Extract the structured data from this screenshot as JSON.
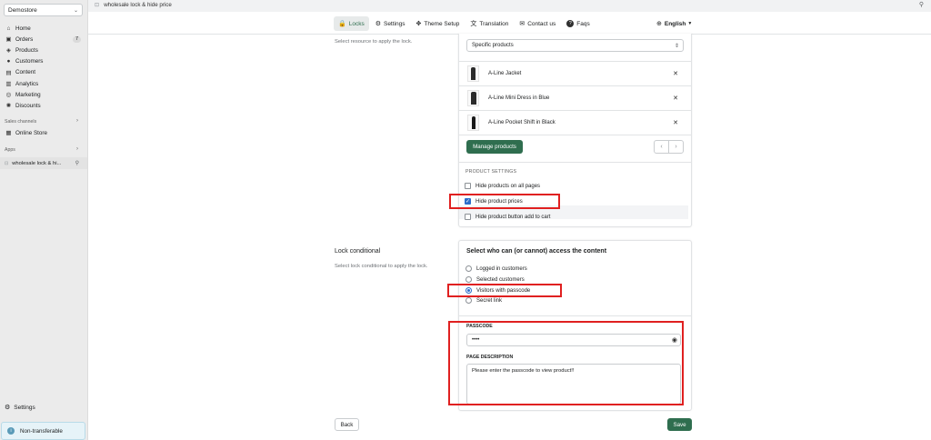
{
  "sidebar": {
    "store_name": "Demostore",
    "items": [
      {
        "label": "Home",
        "icon": "home-icon",
        "glyph": "⌂"
      },
      {
        "label": "Orders",
        "icon": "orders-icon",
        "glyph": "▣",
        "badge": "7"
      },
      {
        "label": "Products",
        "icon": "tag-icon",
        "glyph": "◈"
      },
      {
        "label": "Customers",
        "icon": "person-icon",
        "glyph": "●"
      },
      {
        "label": "Content",
        "icon": "content-icon",
        "glyph": "▤"
      },
      {
        "label": "Analytics",
        "icon": "analytics-icon",
        "glyph": "▥"
      },
      {
        "label": "Marketing",
        "icon": "marketing-icon",
        "glyph": "◎"
      },
      {
        "label": "Discounts",
        "icon": "discount-icon",
        "glyph": "✺"
      }
    ],
    "sales_channels_label": "Sales channels",
    "online_store_label": "Online Store",
    "apps_label": "Apps",
    "app_item_label": "wholesale lock & hi...",
    "settings_label": "Settings",
    "nontransferable_label": "Non-transferable"
  },
  "topbar": {
    "title": "wholesale lock & hide price"
  },
  "tabs": [
    {
      "label": "Locks",
      "icon": "lock-icon",
      "glyph": "🔒",
      "active": true
    },
    {
      "label": "Settings",
      "icon": "gear-icon",
      "glyph": "⚙"
    },
    {
      "label": "Theme Setup",
      "icon": "theme-icon",
      "glyph": "✥"
    },
    {
      "label": "Translation",
      "icon": "translate-icon",
      "glyph": "文"
    },
    {
      "label": "Contact us",
      "icon": "mail-icon",
      "glyph": "✉"
    },
    {
      "label": "Faqs",
      "icon": "question-icon",
      "glyph": "?"
    }
  ],
  "language": {
    "label": "English",
    "icon": "globe-icon"
  },
  "resource": {
    "hint": "Select resource to apply the lock.",
    "select_value": "Specific products",
    "products": [
      "A-Line Jacket",
      "A-Line Mini Dress in Blue",
      "A-Line Pocket Shift in Black"
    ],
    "manage_button": "Manage products",
    "settings_heading": "PRODUCT SETTINGS",
    "checkboxes": [
      {
        "label": "Hide products on all pages",
        "checked": false
      },
      {
        "label": "Hide product prices",
        "checked": true
      },
      {
        "label": "Hide product button add to cart",
        "checked": false
      }
    ]
  },
  "lock_conditional": {
    "title": "Lock conditional",
    "hint": "Select lock conditional to apply the lock.",
    "card_title": "Select who can (or cannot) access the content",
    "options": [
      {
        "label": "Logged in customers",
        "selected": false
      },
      {
        "label": "Selected customers",
        "selected": false
      },
      {
        "label": "Visitors with passcode",
        "selected": true
      },
      {
        "label": "Secret link",
        "selected": false
      }
    ],
    "passcode_label": "PASSCODE",
    "passcode_value": "••••",
    "description_label": "PAGE DESCRIPTION",
    "description_value": "Please enter the passcode to view product!!"
  },
  "footer": {
    "back_label": "Back",
    "save_label": "Save"
  },
  "colors": {
    "accent_green": "#2f6e4f",
    "highlight_red": "#e02020",
    "checkbox_blue": "#2c6ecb"
  }
}
